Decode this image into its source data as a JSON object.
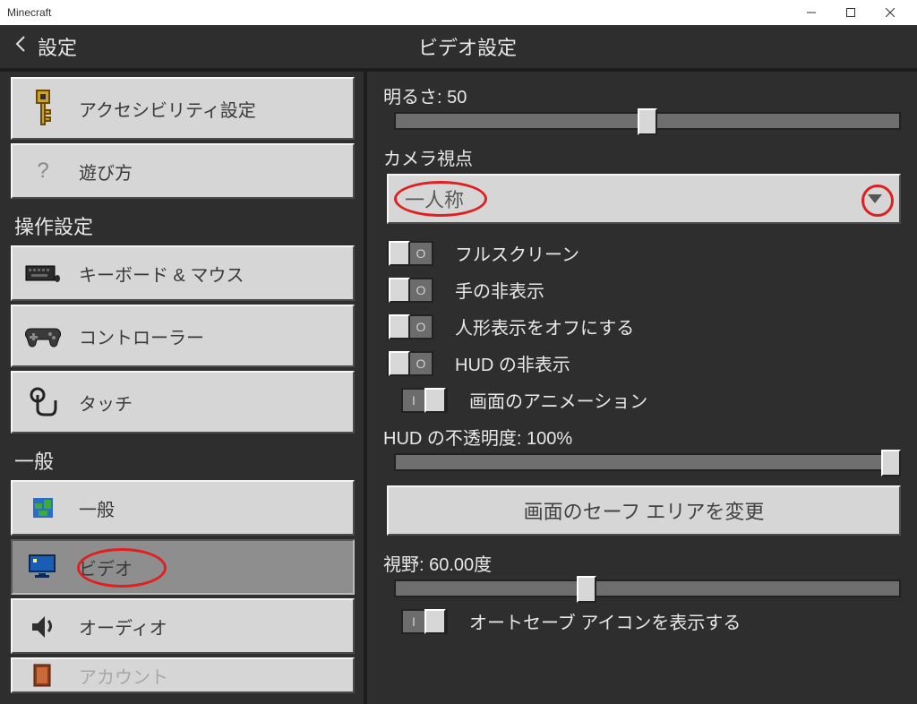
{
  "window": {
    "title": "Minecraft"
  },
  "header": {
    "back_label": "設定",
    "page_title": "ビデオ設定"
  },
  "sidebar": {
    "items": [
      {
        "label": "アクセシビリティ設定",
        "icon": "key-icon"
      },
      {
        "label": "遊び方",
        "icon": "question-icon"
      }
    ],
    "sections": [
      {
        "title": "操作設定",
        "items": [
          {
            "label": "キーボード & マウス",
            "icon": "keyboard-icon"
          },
          {
            "label": "コントローラー",
            "icon": "gamepad-icon"
          },
          {
            "label": "タッチ",
            "icon": "touch-icon"
          }
        ]
      },
      {
        "title": "一般",
        "items": [
          {
            "label": "一般",
            "icon": "world-icon"
          },
          {
            "label": "ビデオ",
            "icon": "monitor-icon",
            "selected": true
          },
          {
            "label": "オーディオ",
            "icon": "audio-icon"
          },
          {
            "label": "アカウント",
            "icon": "book-icon"
          }
        ]
      }
    ]
  },
  "settings": {
    "brightness_label": "明るさ",
    "brightness_value": "50",
    "camera_label": "カメラ視点",
    "camera_value": "一人称",
    "toggles": {
      "fullscreen": "フルスクリーン",
      "hide_hand": "手の非表示",
      "hide_paper_doll": "人形表示をオフにする",
      "hide_hud": "HUD の非表示",
      "screen_anim": "画面のアニメーション",
      "autosave_icon": "オートセーブ アイコンを表示する"
    },
    "hud_opacity_label": "HUD の不透明度",
    "hud_opacity_value": "100%",
    "safe_area_btn": "画面のセーフ エリアを変更",
    "fov_label": "視野",
    "fov_value": "60.00度"
  }
}
